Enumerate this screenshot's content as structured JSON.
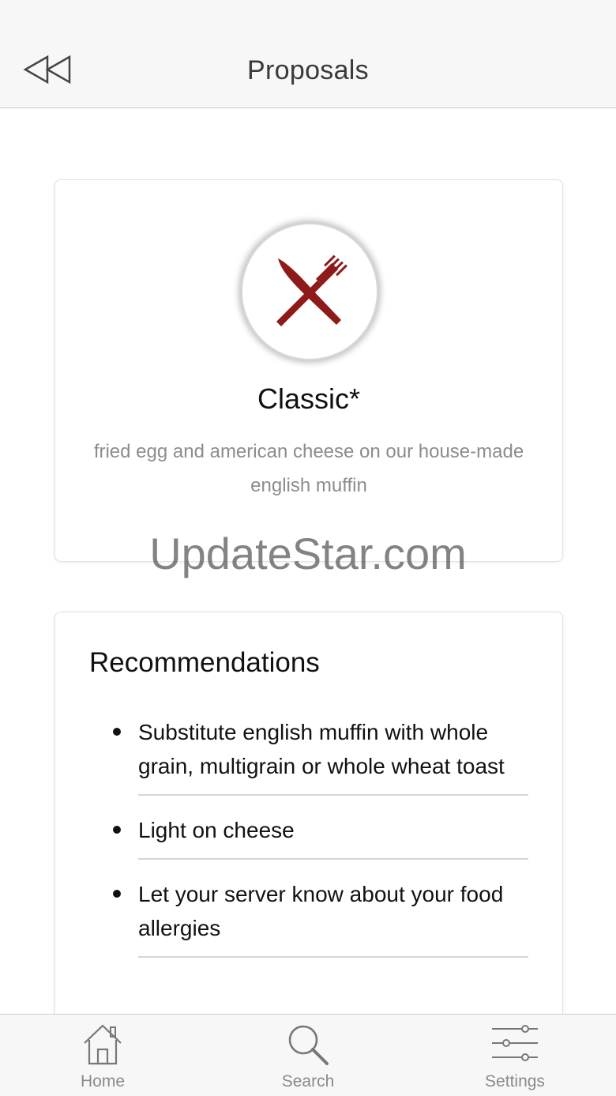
{
  "header": {
    "title": "Proposals",
    "back_icon": "rewind-back-icon"
  },
  "item": {
    "icon": "fork-knife-icon",
    "icon_color": "#8e1a1a",
    "title": "Classic*",
    "description": "fried egg and american cheese on our house-made english muffin"
  },
  "recommendations": {
    "title": "Recommendations",
    "items": [
      {
        "text": "Substitute english muffin with whole grain, multigrain or whole wheat toast"
      },
      {
        "text": "Light on cheese"
      },
      {
        "text": "Let your server know about your food allergies"
      }
    ]
  },
  "watermark": "UpdateStar.com",
  "tabbar": {
    "tabs": [
      {
        "label": "Home",
        "icon": "home-icon"
      },
      {
        "label": "Search",
        "icon": "search-icon"
      },
      {
        "label": "Settings",
        "icon": "settings-sliders-icon"
      }
    ]
  }
}
